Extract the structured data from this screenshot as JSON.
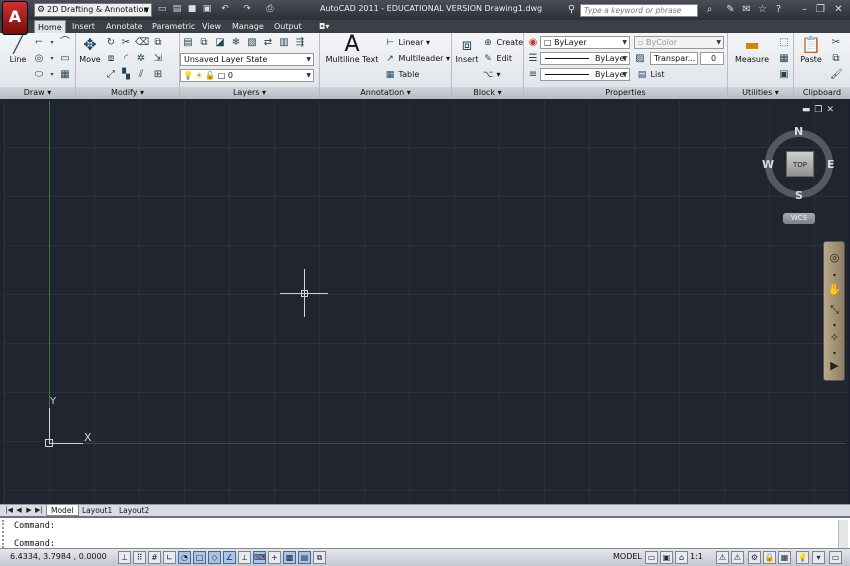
{
  "titlebar": {
    "app_letter": "A",
    "workspace": "2D Drafting & Annotation",
    "title": "AutoCAD 2011 - EDUCATIONAL VERSION    Drawing1.dwg",
    "search_placeholder": "Type a keyword or phrase"
  },
  "tabs": [
    "Home",
    "Insert",
    "Annotate",
    "Parametric",
    "View",
    "Manage",
    "Output"
  ],
  "ribbon": {
    "draw": {
      "title": "Draw",
      "line": "Line"
    },
    "modify": {
      "title": "Modify",
      "move": "Move"
    },
    "layers": {
      "title": "Layers",
      "layer_state": "Unsaved Layer State",
      "layer": "0"
    },
    "annotation": {
      "title": "Annotation",
      "mtext": "Multiline Text",
      "linear": "Linear",
      "multileader": "Multileader",
      "table": "Table"
    },
    "block": {
      "title": "Block",
      "insert": "Insert",
      "create": "Create",
      "edit": "Edit"
    },
    "properties": {
      "title": "Properties",
      "color": "ByLayer",
      "color2": "ByColor",
      "linetype": "ByLayer",
      "lineweight": "ByLayer",
      "transparency": "Transpar...",
      "transparency_value": "0",
      "list": "List"
    },
    "utilities": {
      "title": "Utilities",
      "measure": "Measure"
    },
    "clipboard": {
      "title": "Clipboard",
      "paste": "Paste"
    }
  },
  "viewcube": {
    "n": "N",
    "s": "S",
    "e": "E",
    "w": "W",
    "face": "TOP",
    "wcs": "WCS"
  },
  "ucs": {
    "x": "X",
    "y": "Y"
  },
  "layout_tabs": [
    "Model",
    "Layout1",
    "Layout2"
  ],
  "command": {
    "line1": "Command:",
    "line2": "Command:"
  },
  "status": {
    "coords": "6.4334, 3.7984 , 0.0000",
    "model": "MODEL",
    "scale": "1:1"
  }
}
